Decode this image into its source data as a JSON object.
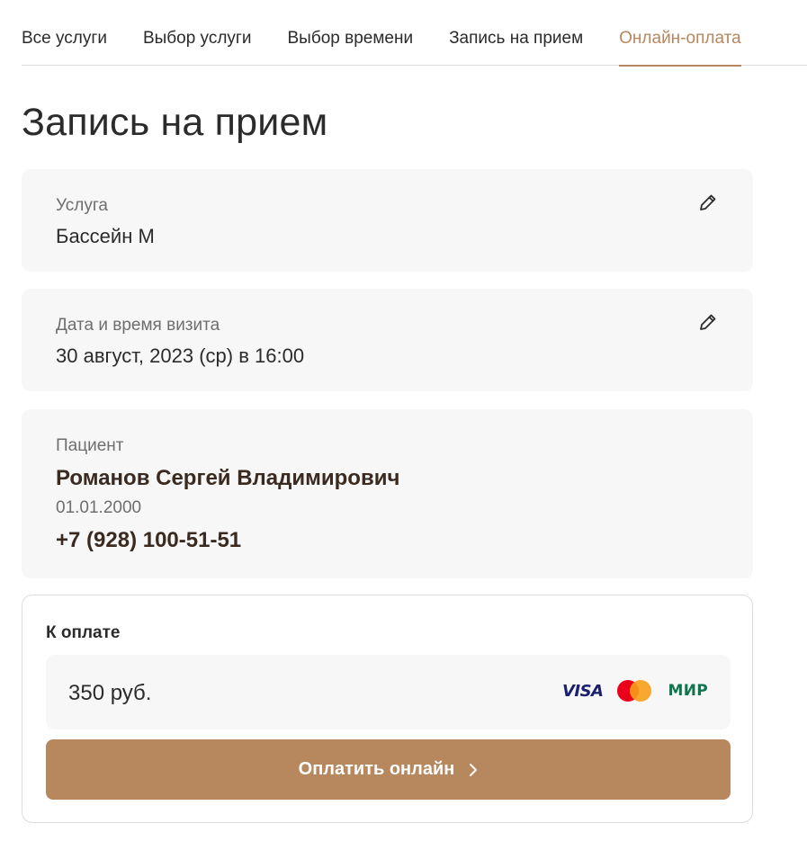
{
  "tabs": [
    {
      "label": "Все услуги",
      "active": false
    },
    {
      "label": "Выбор услуги",
      "active": false
    },
    {
      "label": "Выбор времени",
      "active": false
    },
    {
      "label": "Запись на прием",
      "active": false
    },
    {
      "label": "Онлайн-оплата",
      "active": true
    }
  ],
  "page_title": "Запись на прием",
  "service": {
    "label": "Услуга",
    "value": "Бассейн М",
    "edit_icon": "pencil-icon"
  },
  "visit": {
    "label": "Дата и время визита",
    "value": "30 август, 2023 (ср) в 16:00",
    "edit_icon": "pencil-icon"
  },
  "patient": {
    "label": "Пациент",
    "name": "Романов Сергей Владимирович",
    "dob": "01.01.2000",
    "phone": "+7 (928) 100-51-51"
  },
  "payment": {
    "title": "К оплате",
    "amount": "350 руб.",
    "logos": {
      "visa": "VISA",
      "mastercard": "mastercard-logo",
      "mir": "МИР"
    },
    "button_label": "Оплатить онлайн",
    "button_icon": "chevron-right-icon"
  },
  "colors": {
    "accent": "#b7865e",
    "card_bg": "#f7f7f7",
    "text": "#2b2b2b",
    "muted": "#6e6e6e"
  }
}
